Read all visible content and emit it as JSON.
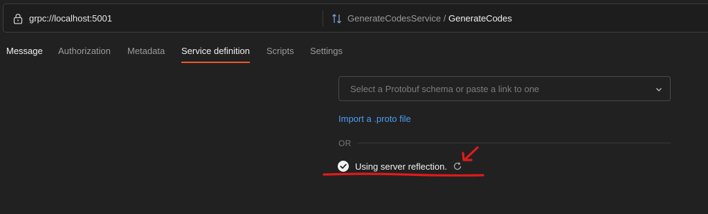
{
  "address_bar": {
    "url": "grpc://localhost:5001",
    "service": "GenerateCodesService",
    "separator": " / ",
    "method": "GenerateCodes"
  },
  "tabs": [
    {
      "label": "Message",
      "active_text": true
    },
    {
      "label": "Authorization"
    },
    {
      "label": "Metadata"
    },
    {
      "label": "Service definition",
      "selected": true
    },
    {
      "label": "Scripts"
    },
    {
      "label": "Settings"
    }
  ],
  "service_definition": {
    "schema_placeholder": "Select a Protobuf schema or paste a link to one",
    "import_link": "Import a .proto file",
    "or_label": "OR",
    "reflection_status": "Using server reflection."
  },
  "colors": {
    "accent": "#ec5b2d",
    "link": "#4d9cf5",
    "annotation": "#e01b1b"
  },
  "icons": {
    "lock": "lock-icon",
    "method": "sort-arrows-icon",
    "dropdown": "chevron-down-icon",
    "status": "check-circle-icon",
    "refresh": "refresh-icon"
  }
}
